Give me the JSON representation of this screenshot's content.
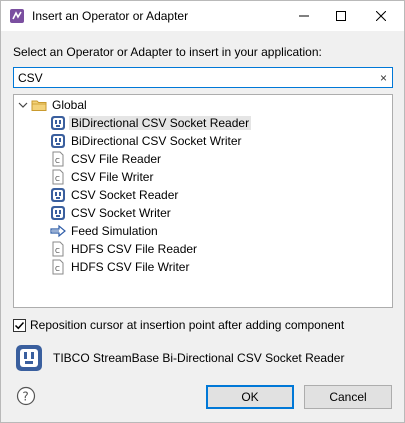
{
  "window": {
    "title": "Insert an Operator or Adapter"
  },
  "prompt": "Select an Operator or Adapter to insert in your application:",
  "search": {
    "value": "CSV",
    "clear_icon": "×"
  },
  "tree": {
    "group": "Global",
    "items": [
      {
        "label": "BiDirectional CSV Socket Reader",
        "icon": "adapter-icon",
        "selected": true
      },
      {
        "label": "BiDirectional CSV Socket Writer",
        "icon": "adapter-icon",
        "selected": false
      },
      {
        "label": "CSV File Reader",
        "icon": "file-adapter-icon",
        "selected": false
      },
      {
        "label": "CSV File Writer",
        "icon": "file-adapter-icon",
        "selected": false
      },
      {
        "label": "CSV Socket Reader",
        "icon": "adapter-icon",
        "selected": false
      },
      {
        "label": "CSV Socket Writer",
        "icon": "adapter-icon",
        "selected": false
      },
      {
        "label": "Feed Simulation",
        "icon": "feed-simulation-icon",
        "selected": false
      },
      {
        "label": "HDFS CSV File Reader",
        "icon": "file-adapter-icon",
        "selected": false
      },
      {
        "label": "HDFS CSV File Writer",
        "icon": "file-adapter-icon",
        "selected": false
      }
    ]
  },
  "reposition": {
    "label": "Reposition cursor at insertion point after adding component",
    "checked": true
  },
  "description": "TIBCO StreamBase Bi-Directional CSV Socket Reader",
  "buttons": {
    "ok": "OK",
    "cancel": "Cancel"
  },
  "colors": {
    "accent": "#0078d7",
    "selection": "#e5e5e5",
    "folder": "#e8b84a"
  }
}
